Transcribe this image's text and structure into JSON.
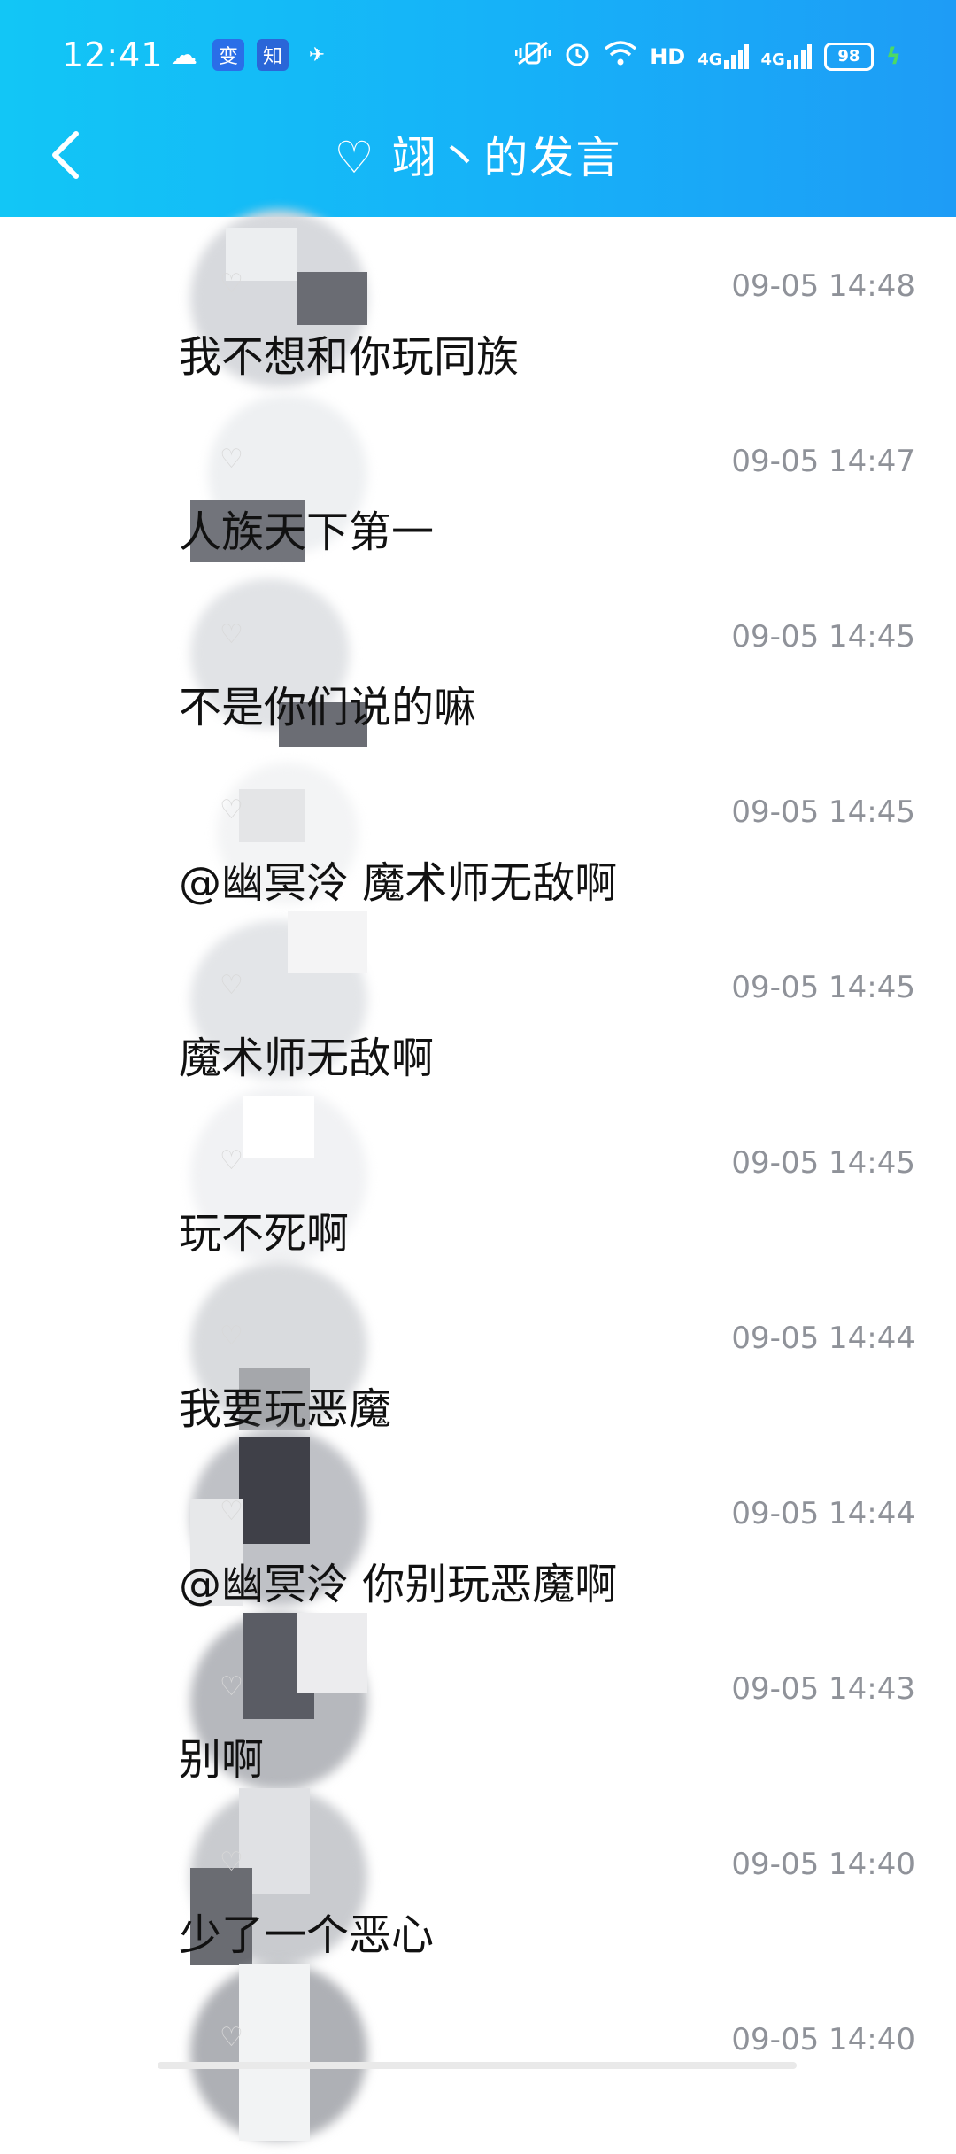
{
  "status_bar": {
    "time": "12:41",
    "app_icons": [
      "wechat-icon",
      "app-icon-bian",
      "zhihu-icon",
      "app-icon-misc"
    ],
    "app_icon_chars": [
      "☁",
      "变",
      "知",
      "✈"
    ],
    "network_label": "HD",
    "signal_1": "4G",
    "signal_2": "4G",
    "battery": "98",
    "colors": {
      "header_start": "#12c6f6",
      "header_end": "#1e9cf6",
      "charge": "#4cd964"
    }
  },
  "header": {
    "title": "♡ 翊丶的发言"
  },
  "messages": [
    {
      "time": "09-05 14:48",
      "text": "我不想和你玩同族"
    },
    {
      "time": "09-05 14:47",
      "text": "人族天下第一"
    },
    {
      "time": "09-05 14:45",
      "text": "不是你们说的嘛"
    },
    {
      "time": "09-05 14:45",
      "text": "@幽冥泠 魔术师无敌啊"
    },
    {
      "time": "09-05 14:45",
      "text": "魔术师无敌啊"
    },
    {
      "time": "09-05 14:45",
      "text": "玩不死啊"
    },
    {
      "time": "09-05 14:44",
      "text": "我要玩恶魔"
    },
    {
      "time": "09-05 14:44",
      "text": "@幽冥泠 你别玩恶魔啊"
    },
    {
      "time": "09-05 14:43",
      "text": "别啊"
    },
    {
      "time": "09-05 14:40",
      "text": "少了一个恶心"
    },
    {
      "time": "09-05 14:40",
      "text": ""
    }
  ]
}
